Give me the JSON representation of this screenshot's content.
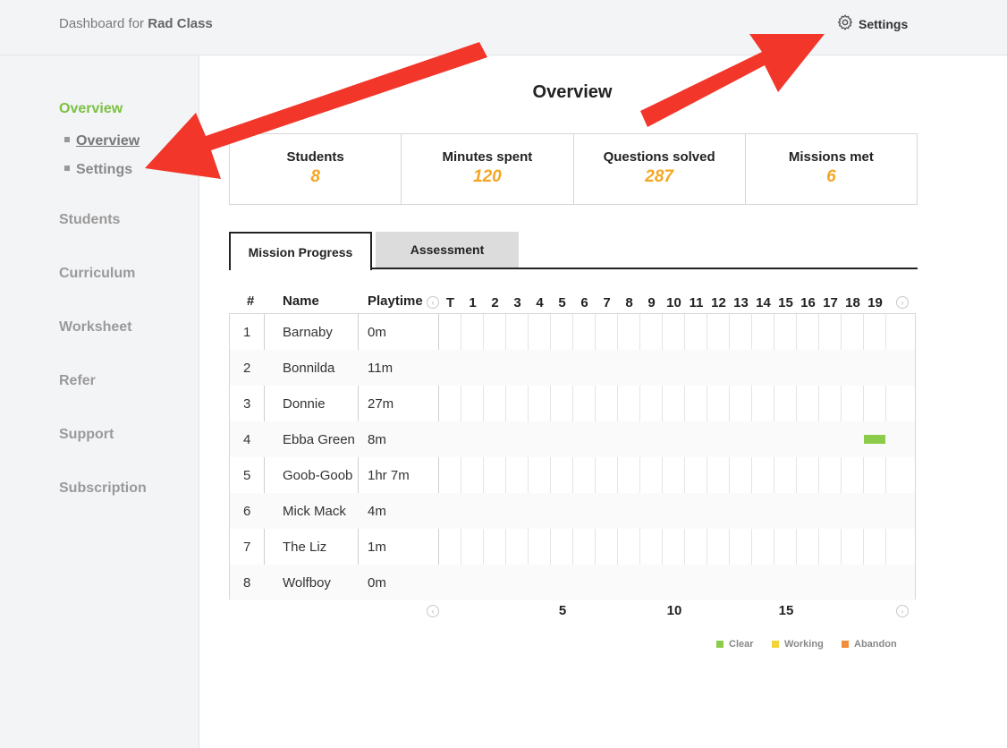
{
  "header": {
    "brand_prefix": "Dashboard for",
    "class_name": "Rad Class",
    "settings_label": "Settings"
  },
  "sidebar": {
    "items": [
      {
        "label": "Overview",
        "active": true
      },
      {
        "label": "Students"
      },
      {
        "label": "Curriculum"
      },
      {
        "label": "Worksheet"
      },
      {
        "label": "Refer"
      },
      {
        "label": "Support"
      },
      {
        "label": "Subscription"
      }
    ],
    "subitems": [
      {
        "label": "Overview",
        "current": true
      },
      {
        "label": "Settings"
      }
    ]
  },
  "main": {
    "title": "Overview",
    "stats": [
      {
        "label": "Students",
        "value": "8"
      },
      {
        "label": "Minutes spent",
        "value": "120"
      },
      {
        "label": "Questions solved",
        "value": "287"
      },
      {
        "label": "Missions met",
        "value": "6"
      }
    ],
    "tabs": [
      {
        "label": "Mission Progress",
        "active": true
      },
      {
        "label": "Assessment"
      }
    ],
    "table": {
      "headers": {
        "num": "#",
        "name": "Name",
        "playtime": "Playtime"
      },
      "mission_columns": [
        "T",
        "1",
        "2",
        "3",
        "4",
        "5",
        "6",
        "7",
        "8",
        "9",
        "10",
        "11",
        "12",
        "13",
        "14",
        "15",
        "16",
        "17",
        "18",
        "19"
      ],
      "footer_ticks": [
        "5",
        "10",
        "15"
      ],
      "rows": [
        {
          "num": "1",
          "name": "Barnaby",
          "playtime": "0m"
        },
        {
          "num": "2",
          "name": "Bonnilda",
          "playtime": "11m"
        },
        {
          "num": "3",
          "name": "Donnie",
          "playtime": "27m"
        },
        {
          "num": "4",
          "name": "Ebba Green",
          "playtime": "8m",
          "progress": {
            "mission": "19",
            "status": "Clear"
          }
        },
        {
          "num": "5",
          "name": "Goob-Goob",
          "playtime": "1hr 7m"
        },
        {
          "num": "6",
          "name": "Mick Mack",
          "playtime": "4m"
        },
        {
          "num": "7",
          "name": "The Liz",
          "playtime": "1m"
        },
        {
          "num": "8",
          "name": "Wolfboy",
          "playtime": "0m"
        }
      ]
    },
    "legend": [
      {
        "label": "Clear",
        "color": "#8ccc4a"
      },
      {
        "label": "Working",
        "color": "#f2d43a"
      },
      {
        "label": "Abandon",
        "color": "#f28c3a"
      }
    ]
  },
  "colors": {
    "accent_green": "#7cc142",
    "stat_orange": "#f5a623",
    "annotation_red": "#f2362a"
  },
  "icons": {
    "settings": "gear-icon",
    "prev": "chevron-left-icon",
    "next": "chevron-right-icon"
  }
}
